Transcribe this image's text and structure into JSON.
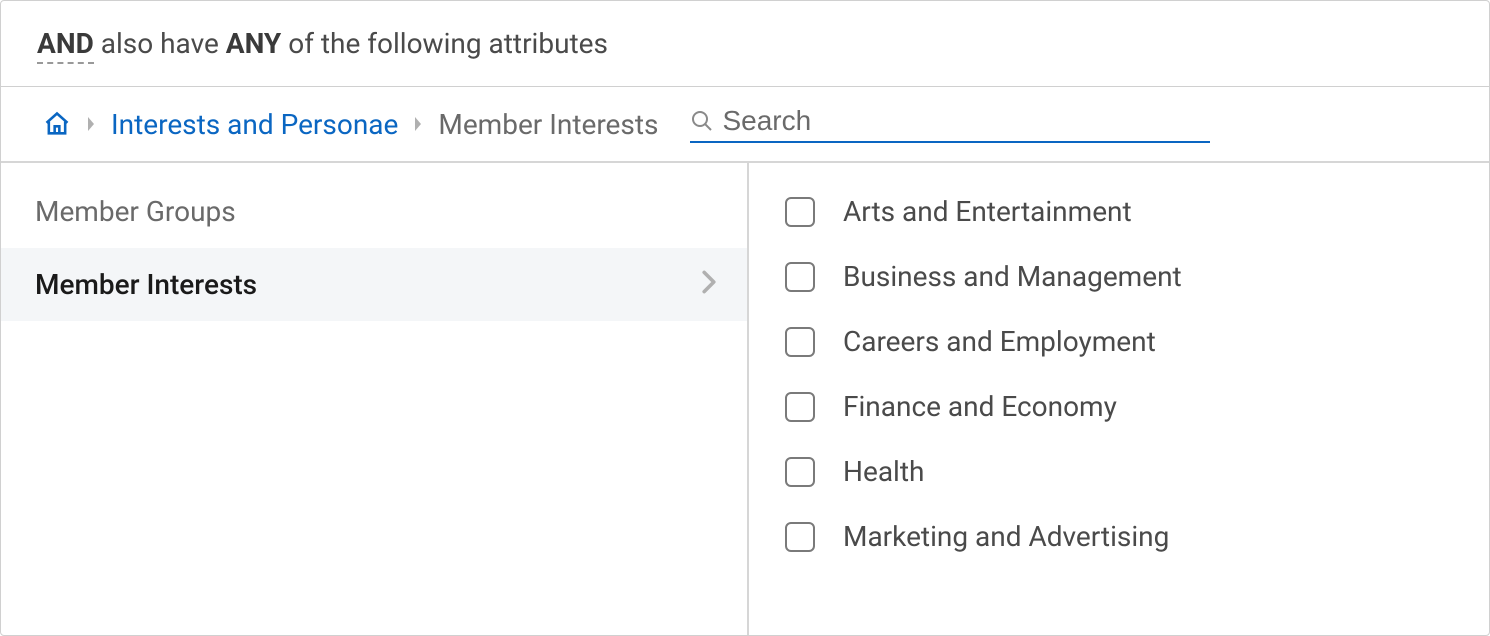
{
  "header": {
    "kw_and": "AND",
    "text_mid": " also have ",
    "kw_any": "ANY",
    "text_end": " of the following attributes"
  },
  "breadcrumb": {
    "link_interests": "Interests and Personae",
    "current": "Member Interests"
  },
  "search": {
    "placeholder": "Search",
    "value": ""
  },
  "left_panel": {
    "items": [
      {
        "label": "Member Groups",
        "selected": false,
        "has_chevron": false
      },
      {
        "label": "Member Interests",
        "selected": true,
        "has_chevron": true
      }
    ]
  },
  "right_panel": {
    "items": [
      {
        "label": "Arts and Entertainment",
        "checked": false
      },
      {
        "label": "Business and Management",
        "checked": false
      },
      {
        "label": "Careers and Employment",
        "checked": false
      },
      {
        "label": "Finance and Economy",
        "checked": false
      },
      {
        "label": "Health",
        "checked": false
      },
      {
        "label": "Marketing and Advertising",
        "checked": false
      }
    ]
  }
}
